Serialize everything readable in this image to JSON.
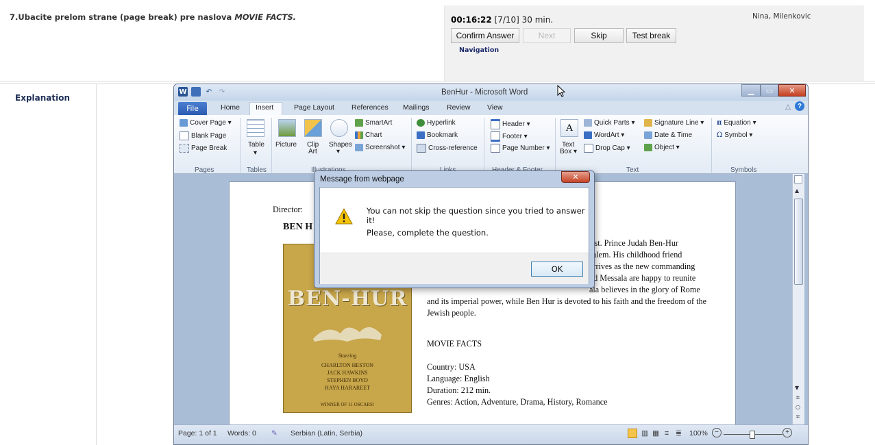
{
  "exam": {
    "question_prefix": "7.Ubacite prelom strane (page break) pre naslova ",
    "question_emph": "MOVIE FACTS.",
    "timer": "00:16:22",
    "progress": "[7/10] 30 min.",
    "buttons": {
      "confirm": "Confirm Answer",
      "next": "Next",
      "skip": "Skip",
      "test_break": "Test break"
    },
    "navigation_label": "Navigation",
    "user_name": "Nina, Milenkovic",
    "explanation_label": "Explanation"
  },
  "word": {
    "title": "BenHur - Microsoft Word",
    "qat_icons": [
      "word-logo-icon",
      "save-icon",
      "undo-icon",
      "redo-icon"
    ],
    "window_controls": [
      "minimize-icon",
      "maximize-icon",
      "close-icon"
    ],
    "tabs": [
      "File",
      "Home",
      "Insert",
      "Page Layout",
      "References",
      "Mailings",
      "Review",
      "View"
    ],
    "active_tab": "Insert",
    "ribbon": {
      "pages": {
        "cover_page": "Cover Page ▾",
        "blank_page": "Blank Page",
        "page_break": "Page Break",
        "group": "Pages"
      },
      "tables": {
        "table": "Table",
        "table_arrow": "▾",
        "group": "Tables"
      },
      "illustrations": {
        "picture": "Picture",
        "clip": "Clip",
        "art": "Art",
        "shapes": "Shapes",
        "shapes_arrow": "▾",
        "smartart": "SmartArt",
        "chart": "Chart",
        "screenshot": "Screenshot ▾",
        "group": "Illustrations"
      },
      "links": {
        "hyperlink": "Hyperlink",
        "bookmark": "Bookmark",
        "cross_reference": "Cross-reference",
        "group": "Links"
      },
      "header_footer": {
        "header": "Header ▾",
        "footer": "Footer ▾",
        "page_number": "Page Number ▾",
        "group": "Header & Footer"
      },
      "text": {
        "text_box": "Text",
        "text_box2": "Box ▾",
        "quick_parts": "Quick Parts ▾",
        "wordart": "WordArt ▾",
        "drop_cap": "Drop Cap ▾",
        "signature_line": "Signature Line ▾",
        "date_time": "Date & Time",
        "object": "Object ▾",
        "group": "Text"
      },
      "symbols": {
        "equation": "Equation ▾",
        "symbol": "Symbol ▾",
        "group": "Symbols"
      }
    },
    "document": {
      "director_line": "Director:",
      "title_partial": "BEN H",
      "poster": {
        "title": "BEN-HUR",
        "starring": "Starring",
        "actors": [
          "CHARLTON HESTON",
          "JACK HAWKINS",
          "STEPHEN BOYD",
          "HAYA HARAREET"
        ],
        "winner": "WINNER OF 11 OSCARS!"
      },
      "paragraph_lines": [
        "rist. Prince Judah Ben-Hur",
        "salem. His childhood friend",
        "arrives as the new commanding",
        "nd Messala are happy to reunite",
        "ala believes in the glory of Rome",
        "and its imperial power, while Ben Hur is devoted to his faith and the freedom of the",
        "Jewish people."
      ],
      "facts_heading": "MOVIE FACTS",
      "facts": [
        "Country: USA",
        "Language: English",
        "Duration: 212 min.",
        "Genres: Action, Adventure, Drama, History, Romance"
      ]
    },
    "status": {
      "page": "Page: 1 of 1",
      "words": "Words: 0",
      "language": "Serbian (Latin, Serbia)",
      "zoom": "100%"
    }
  },
  "dialog": {
    "title": "Message from webpage",
    "message1": "You can not skip the question since you tried to answer it!",
    "message2": "Please, complete the question.",
    "ok": "OK"
  }
}
